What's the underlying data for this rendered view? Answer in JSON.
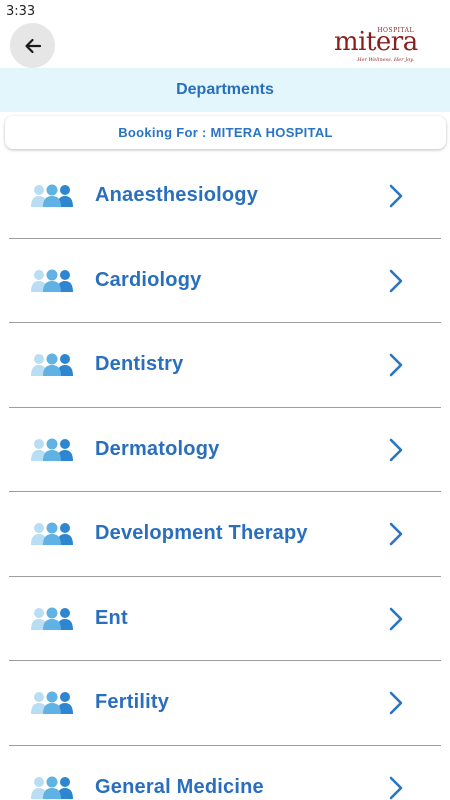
{
  "status_bar": {
    "time": "3:33"
  },
  "header": {
    "back_icon": "arrow-left-icon",
    "logo": {
      "name": "mitera",
      "hospital": "HOSPITAL",
      "tagline": "Her Wellness. Her Joy."
    }
  },
  "title": "Departments",
  "booking": {
    "text": "Booking For : MITERA HOSPITAL"
  },
  "departments": [
    {
      "name": "Anaesthesiology"
    },
    {
      "name": "Cardiology"
    },
    {
      "name": "Dentistry"
    },
    {
      "name": "Dermatology"
    },
    {
      "name": "Development Therapy"
    },
    {
      "name": "Ent"
    },
    {
      "name": "Fertility"
    },
    {
      "name": "General Medicine"
    }
  ],
  "icons": {
    "department": "group-icon",
    "row_action": "chevron-right-icon"
  },
  "colors": {
    "accent": "#2a6fbe",
    "title_bar_bg": "#e3f6fb",
    "logo": "#8b1f1f",
    "people_light": "#b9ddf3",
    "people_mid": "#5fb2e3",
    "people_dark": "#2e86d0"
  }
}
